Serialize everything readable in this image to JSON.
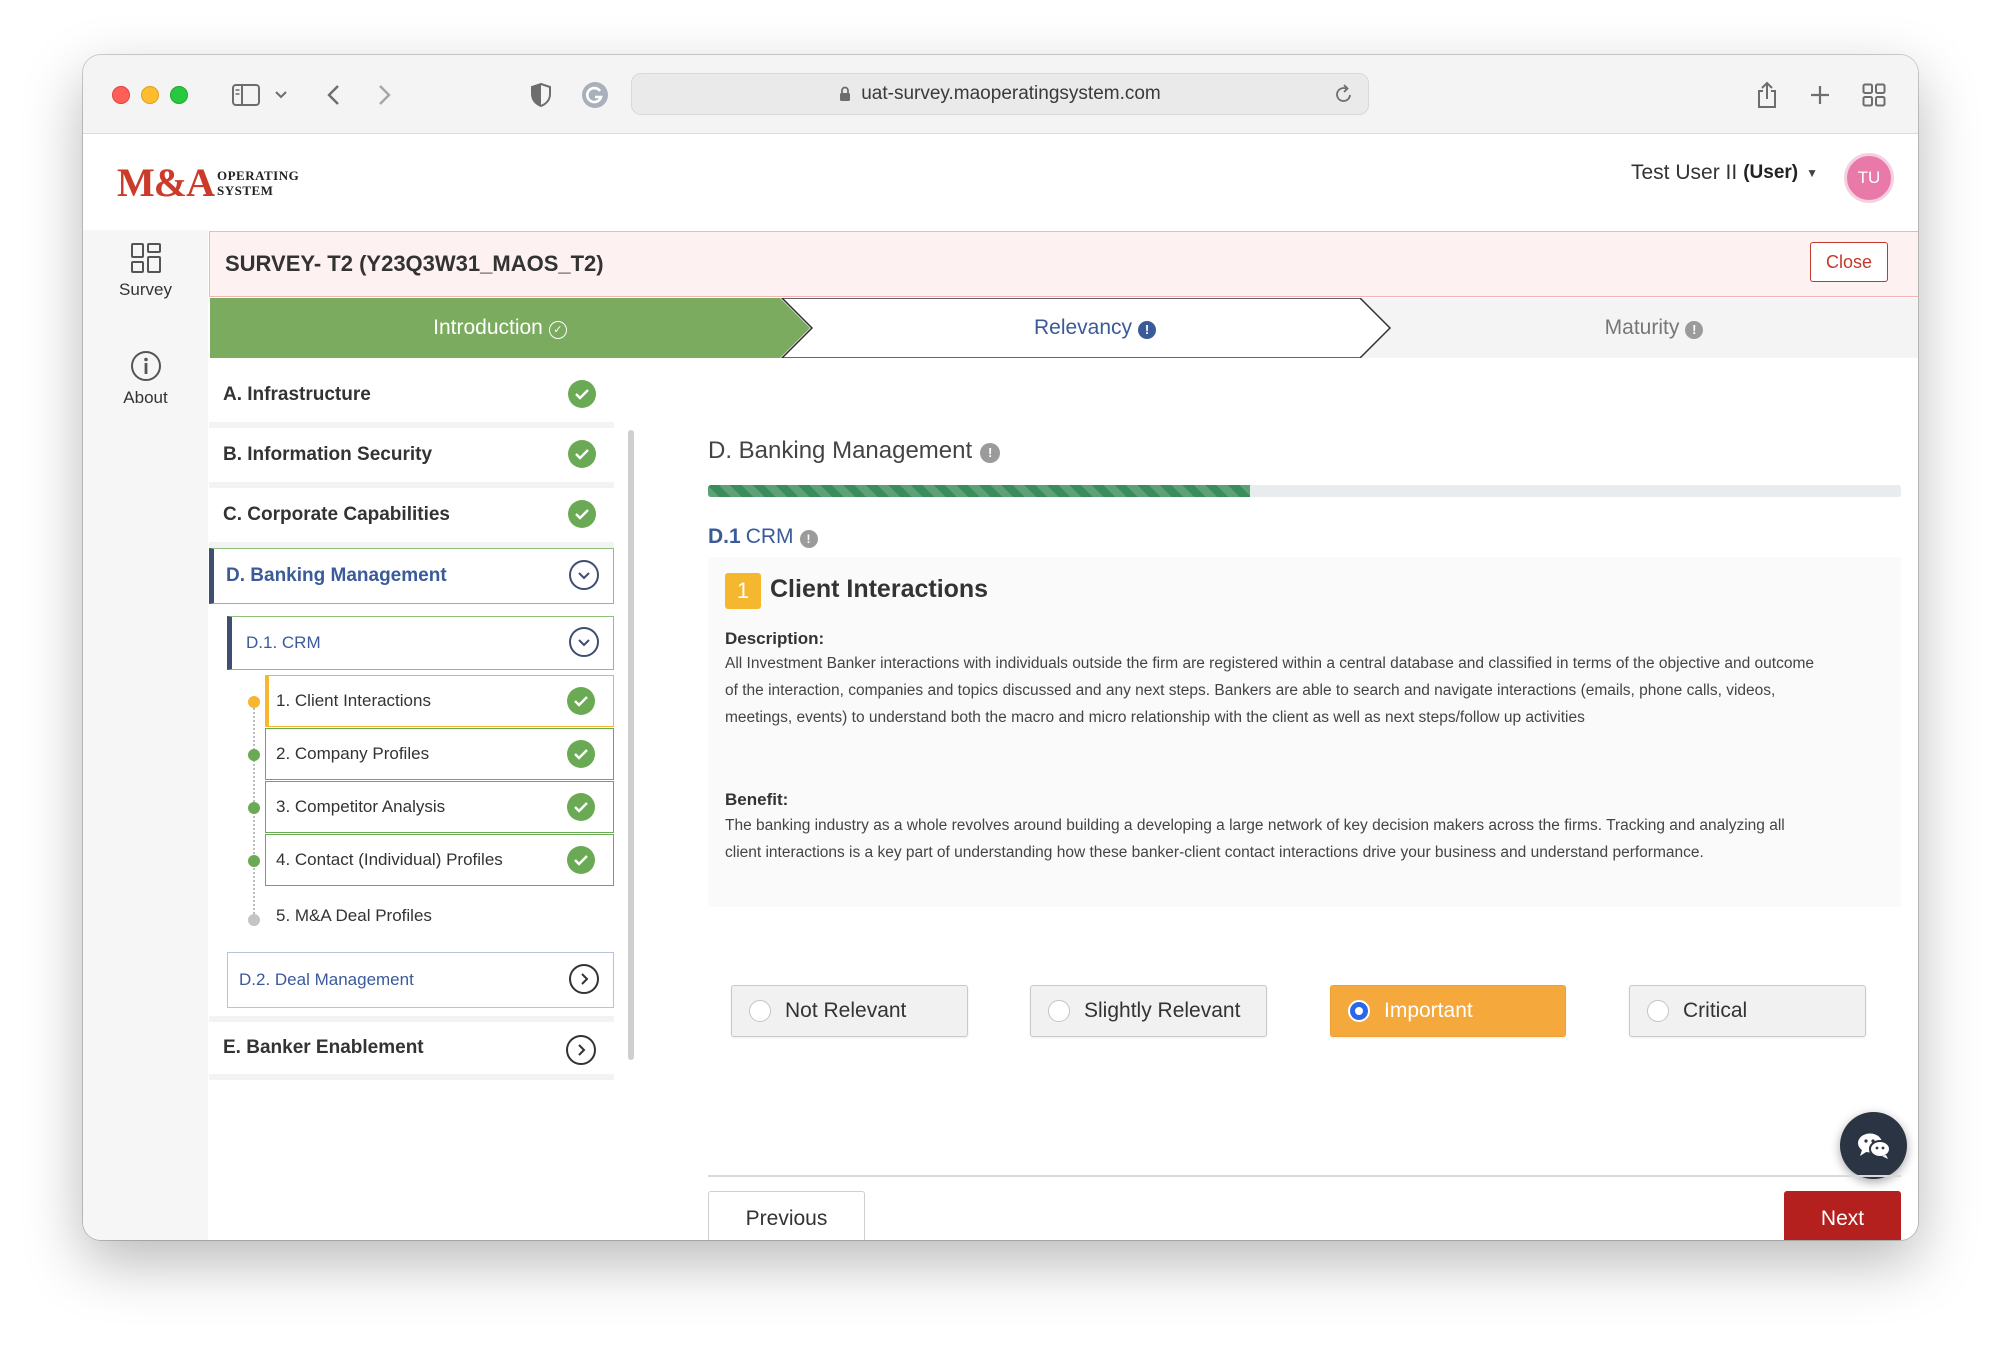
{
  "browser": {
    "url": "uat-survey.maoperatingsystem.com"
  },
  "app": {
    "logo_main": "M&A",
    "logo_sub_1": "OPERATING",
    "logo_sub_2": "SYSTEM",
    "user_name": "Test User II",
    "user_role": "(User)",
    "avatar_initials": "TU"
  },
  "leftnav": {
    "items": [
      {
        "label": "Survey",
        "icon": "grid-icon"
      },
      {
        "label": "About",
        "icon": "info-icon"
      }
    ]
  },
  "survey": {
    "title": "SURVEY- T2 (Y23Q3W31_MAOS_T2)",
    "close_label": "Close",
    "steps": [
      {
        "label": "Introduction",
        "status": "complete",
        "badge": "✓"
      },
      {
        "label": "Relevancy",
        "status": "active",
        "badge": "!"
      },
      {
        "label": "Maturity",
        "status": "pending",
        "badge": "!"
      }
    ]
  },
  "sidebar": {
    "sections": [
      {
        "label": "A. Infrastructure",
        "state": "complete"
      },
      {
        "label": "B. Information Security",
        "state": "complete"
      },
      {
        "label": "C. Corporate Capabilities",
        "state": "complete"
      },
      {
        "label": "D. Banking Management",
        "state": "expanded"
      },
      {
        "label": "E. Banker Enablement",
        "state": "collapsed"
      }
    ],
    "subsections": [
      {
        "label": "D.1. CRM",
        "state": "expanded"
      },
      {
        "label": "D.2. Deal Management",
        "state": "collapsed"
      }
    ],
    "questions": [
      {
        "label": "1. Client Interactions",
        "state": "current",
        "complete": true
      },
      {
        "label": "2. Company Profiles",
        "state": "answered",
        "complete": true
      },
      {
        "label": "3. Competitor Analysis",
        "state": "answered",
        "complete": true
      },
      {
        "label": "4. Contact (Individual) Profiles",
        "state": "answered",
        "complete": true
      },
      {
        "label": "5. M&A Deal Profiles",
        "state": "unanswered",
        "complete": false
      }
    ]
  },
  "main": {
    "section_prefix": "D.",
    "section_title": "Banking Management",
    "progress_fraction": 0.454,
    "subsection_code": "D.1",
    "subsection_name": "CRM",
    "question": {
      "number": "1",
      "title": "Client Interactions",
      "description_label": "Description:",
      "description": "All Investment Banker interactions with individuals outside the firm are registered within a central database and classified in terms of the objective and outcome of the interaction, companies and topics discussed and any next steps. Bankers are able to search and navigate interactions (emails, phone calls, videos, meetings, events) to understand both the macro and micro relationship with the client as well as next steps/follow up activities",
      "benefit_label": "Benefit:",
      "benefit": "The banking industry as a whole revolves around building a developing a large network of key decision makers across the firms. Tracking and analyzing all client interactions is a key part of understanding how these banker-client contact interactions drive your business and understand performance."
    },
    "options": [
      "Not Relevant",
      "Slightly Relevant",
      "Important",
      "Critical"
    ],
    "selected_option": "Important",
    "previous_label": "Previous",
    "next_label": "Next"
  },
  "colors": {
    "brand_red": "#cc3a2a",
    "step_complete": "#7aab5e",
    "accent_blue": "#3a5a9a",
    "selected_orange": "#f5a83b",
    "next_red": "#b3201e",
    "check_green": "#6aaa55"
  }
}
